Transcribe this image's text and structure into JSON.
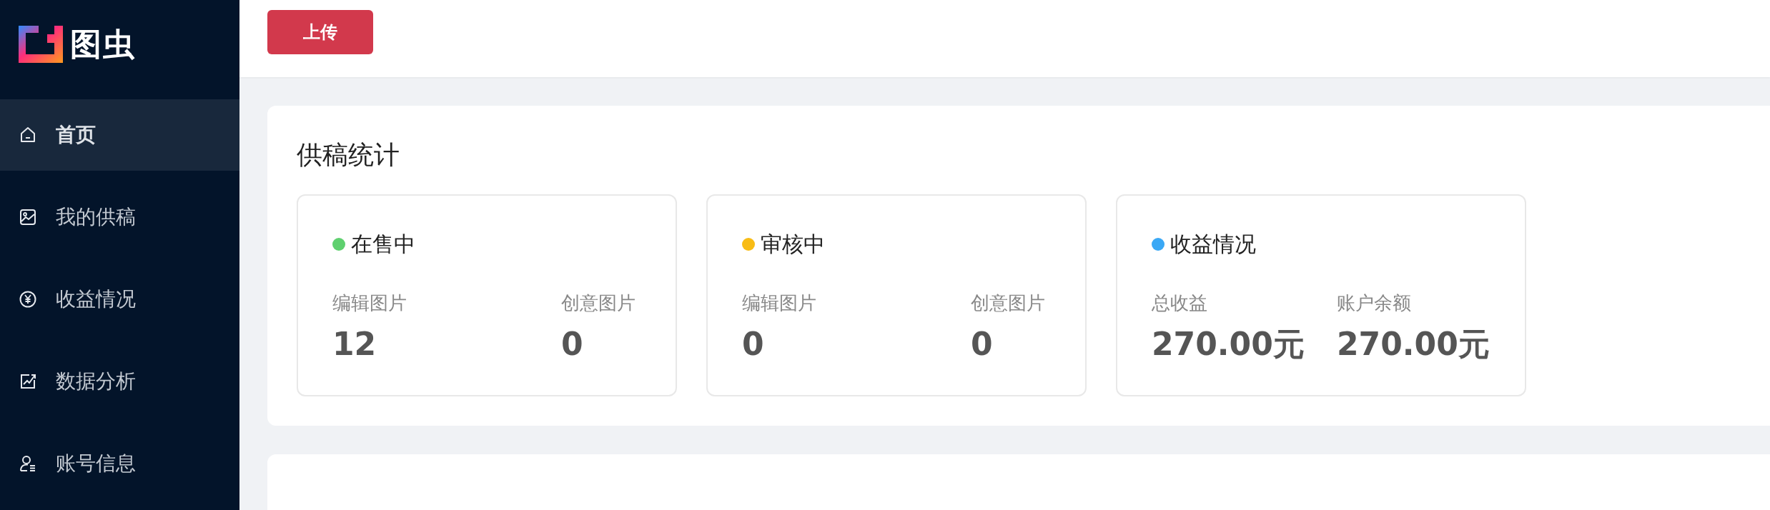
{
  "sidebar": {
    "logo": "图虫",
    "items": [
      {
        "label": "首页",
        "kind": "home",
        "selected": true
      },
      {
        "label": "我的供稿",
        "kind": "image",
        "selected": false
      },
      {
        "label": "收益情况",
        "kind": "yen",
        "selected": false
      },
      {
        "label": "数据分析",
        "kind": "chart",
        "selected": false
      },
      {
        "label": "账号信息",
        "kind": "user",
        "selected": false
      }
    ]
  },
  "toolbar": {
    "upload_button": "上传"
  },
  "stats_panel": {
    "title": "供稿统计",
    "cards": [
      {
        "title": "在售中",
        "color": "#5fd06f",
        "metrics": [
          {
            "label": "编辑图片",
            "value": "12"
          },
          {
            "label": "创意图片",
            "value": "0"
          }
        ]
      },
      {
        "title": "审核中",
        "color": "#f8bc15",
        "metrics": [
          {
            "label": "编辑图片",
            "value": "0"
          },
          {
            "label": "创意图片",
            "value": "0"
          }
        ]
      },
      {
        "title": "收益情况",
        "color": "#3aa8f5",
        "metrics": [
          {
            "label": "总收益",
            "value": "270.00元"
          },
          {
            "label": "账户余额",
            "value": "270.00元"
          }
        ]
      }
    ]
  }
}
